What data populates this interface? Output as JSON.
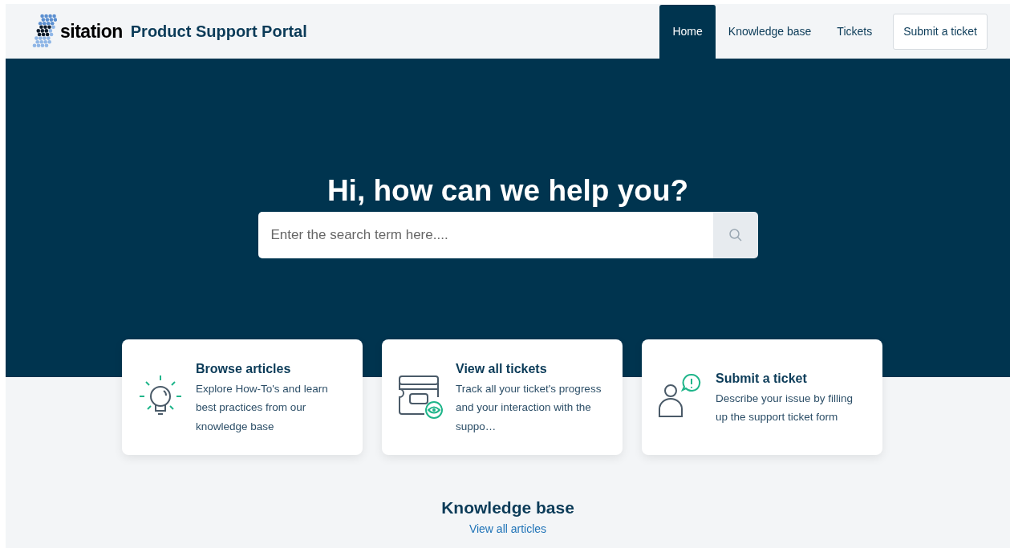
{
  "header": {
    "brand": "sitation",
    "title": "Product Support Portal",
    "nav": [
      {
        "label": "Home",
        "selected": true
      },
      {
        "label": "Knowledge base",
        "selected": false
      },
      {
        "label": "Tickets",
        "selected": false
      }
    ],
    "submit_button": "Submit a ticket"
  },
  "hero": {
    "heading": "Hi, how can we help you?",
    "search": {
      "placeholder": "Enter the search term here...."
    }
  },
  "cards": [
    {
      "kind": "bulb",
      "title": "Browse articles",
      "description": "Explore How-To's and learn best practices from our knowledge base"
    },
    {
      "kind": "tickets",
      "title": "View all tickets",
      "description": "Track all your ticket's progress and your interaction with the suppo…"
    },
    {
      "kind": "person",
      "title": "Submit a ticket",
      "description": "Describe your issue by filling up the support ticket form"
    }
  ],
  "knowledge_base": {
    "heading": "Knowledge base",
    "link": "View all articles"
  }
}
